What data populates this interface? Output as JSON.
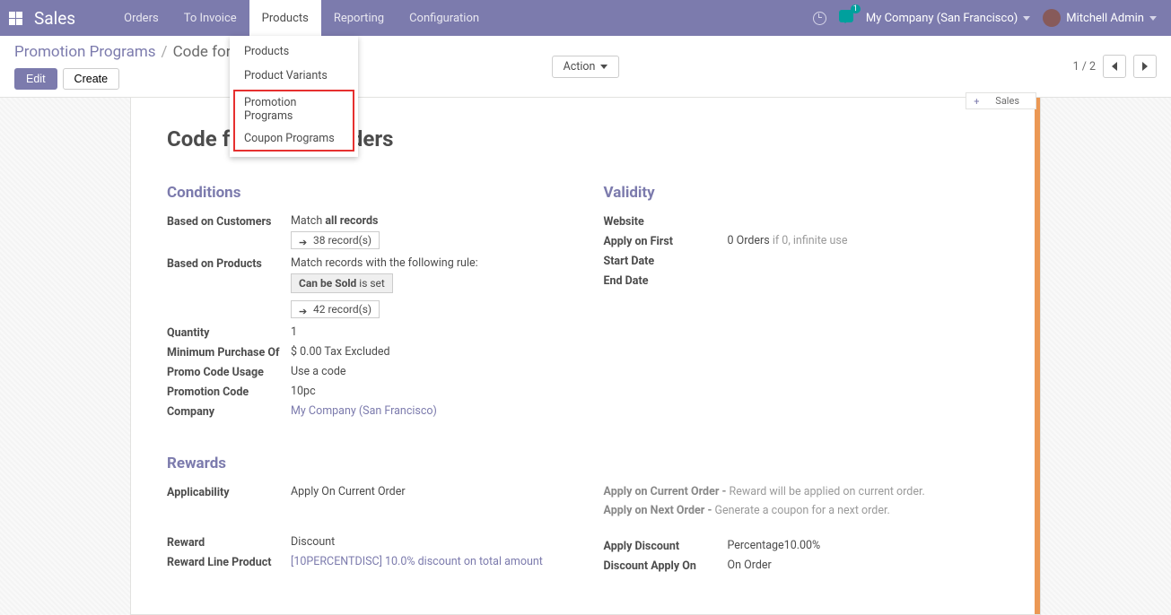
{
  "nav": {
    "brand": "Sales",
    "items": [
      "Orders",
      "To Invoice",
      "Products",
      "Reporting",
      "Configuration"
    ],
    "chat_count": "1",
    "company": "My Company (San Francisco)",
    "user": "Mitchell Admin"
  },
  "dropdown": {
    "items": [
      "Products",
      "Product Variants"
    ],
    "highlighted": [
      "Promotion Programs",
      "Coupon Programs"
    ]
  },
  "breadcrumb": {
    "root": "Promotion Programs",
    "current": "Code for 10",
    "sep": "/"
  },
  "buttons": {
    "edit": "Edit",
    "create": "Create",
    "action": "Action"
  },
  "pager": {
    "range": "1 / 2"
  },
  "stat": {
    "prefix": "+",
    "label": "Sales"
  },
  "title": "Code for 10% on orders",
  "sections": {
    "conditions": "Conditions",
    "validity": "Validity",
    "rewards": "Rewards"
  },
  "conditions": {
    "based_customers_label": "Based on Customers",
    "match_prefix": "Match ",
    "match_all": "all records",
    "rec38": "38 record(s)",
    "based_products_label": "Based on Products",
    "match_rule": "Match records with the following rule:",
    "can_sold": "Can be Sold",
    "is_set": " is set",
    "rec42": "42 record(s)",
    "quantity_label": "Quantity",
    "quantity_val": "1",
    "min_purchase_label": "Minimum Purchase Of",
    "min_purchase_val": "$ 0.00  Tax Excluded",
    "promo_usage_label": "Promo Code Usage",
    "promo_usage_val": "Use a code",
    "promo_code_label": "Promotion Code",
    "promo_code_val": "10pc",
    "company_label": "Company",
    "company_val": "My Company (San Francisco)"
  },
  "validity": {
    "website_label": "Website",
    "apply_first_label": "Apply on First",
    "apply_first_val": "0 Orders",
    "apply_first_hint": " if 0, infinite use",
    "start_label": "Start Date",
    "end_label": "End Date"
  },
  "rewards": {
    "applicability_label": "Applicability",
    "applicability_val": "Apply On Current Order",
    "help1a": "Apply on Current Order - ",
    "help1b": "Reward will be applied on current order.",
    "help2a": "Apply on Next Order - ",
    "help2b": "Generate a coupon for a next order.",
    "reward_label": "Reward",
    "reward_val": "Discount",
    "reward_line_label": "Reward Line Product",
    "reward_line_val": "[10PERCENTDISC] 10.0% discount on total amount",
    "apply_discount_label": "Apply Discount",
    "apply_discount_val": "Percentage10.00%",
    "discount_apply_on_label": "Discount Apply On",
    "discount_apply_on_val": "On Order"
  }
}
